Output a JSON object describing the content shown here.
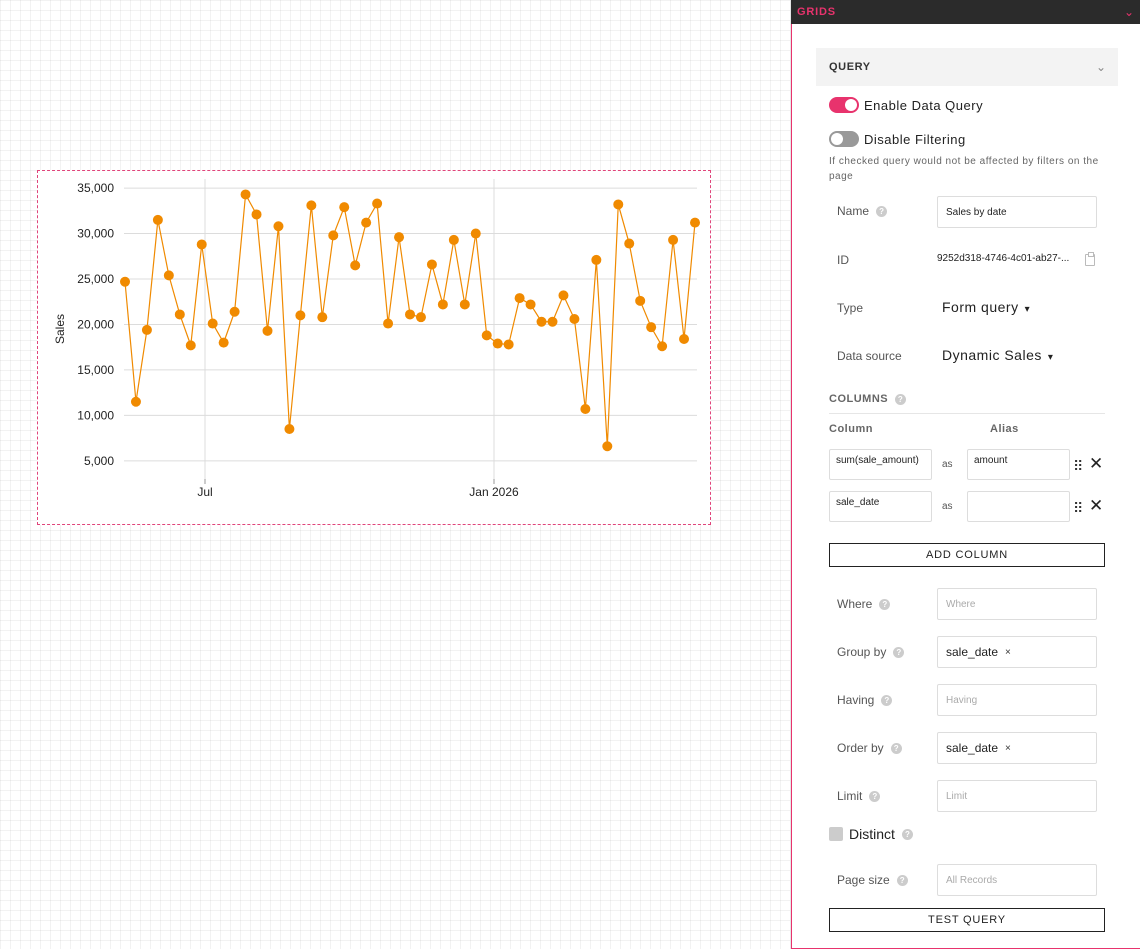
{
  "chart_data": {
    "type": "line",
    "ylabel": "Sales",
    "xlabel": "",
    "x_ticks": [
      "Jul",
      "Jan 2026"
    ],
    "y_ticks": [
      "35,000",
      "30,000",
      "25,000",
      "20,000",
      "15,000",
      "10,000",
      "5,000"
    ],
    "ylim": [
      3000,
      36000
    ],
    "grid": true,
    "marker": "circle",
    "series": [
      {
        "color": "#f08a00",
        "values": [
          24700,
          11500,
          19400,
          31500,
          25400,
          21100,
          17700,
          28800,
          20100,
          18000,
          21400,
          34300,
          32100,
          19300,
          30800,
          8500,
          21000,
          33100,
          20800,
          29800,
          32900,
          26500,
          31200,
          33300,
          20100,
          29600,
          21100,
          20800,
          26600,
          22200,
          29300,
          22200,
          30000,
          18800,
          17900,
          17800,
          22900,
          22200,
          20300,
          20300,
          23200,
          20600,
          10700,
          27100,
          6600,
          33200,
          28900,
          22600,
          19700,
          17600,
          29300,
          18400,
          31200
        ]
      }
    ]
  },
  "panel": {
    "title": "GRIDS",
    "query_title": "QUERY",
    "enable_data_query": "Enable Data Query",
    "disable_filtering": "Disable Filtering",
    "filter_hint": "If checked query would not be affected by filters on the page",
    "name_label": "Name",
    "name_value": "Sales by date",
    "id_label": "ID",
    "id_value": "9252d318-4746-4c01-ab27-...",
    "type_label": "Type",
    "type_value": "Form query",
    "source_label": "Data source",
    "source_value": "Dynamic Sales",
    "columns_title": "COLUMNS",
    "column_head": "Column",
    "alias_head": "Alias",
    "columns": [
      {
        "column": "sum(sale_amount)",
        "as": "as",
        "alias": "amount"
      },
      {
        "column": "sale_date",
        "as": "as",
        "alias": ""
      }
    ],
    "add_column": "ADD COLUMN",
    "where_label": "Where",
    "where_placeholder": "Where",
    "group_by_label": "Group by",
    "group_by_chip": "sale_date",
    "having_label": "Having",
    "having_placeholder": "Having",
    "order_by_label": "Order by",
    "order_by_chip": "sale_date",
    "limit_label": "Limit",
    "limit_placeholder": "Limit",
    "distinct_label": "Distinct",
    "page_size_label": "Page size",
    "page_size_placeholder": "All Records",
    "test_query": "TEST QUERY",
    "help_glyph": "?",
    "chip_remove_glyph": "×",
    "caret_glyph": "▾",
    "chevron_glyph": "⌄",
    "drag_glyph": "⠿",
    "close_glyph": "✕"
  },
  "colors": {
    "accent": "#e8336d",
    "series": "#f08a00"
  }
}
